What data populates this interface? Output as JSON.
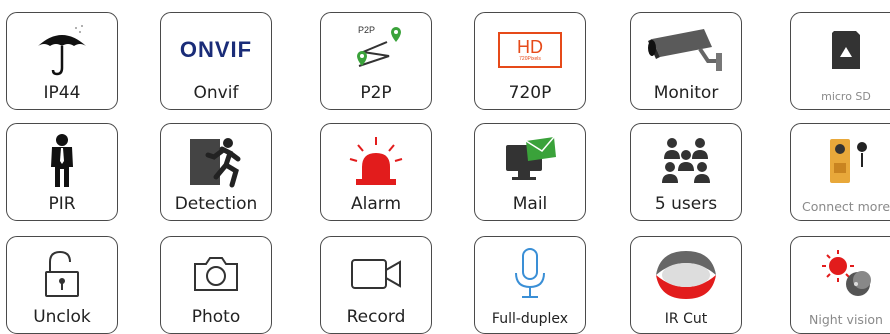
{
  "tiles": [
    {
      "label": "IP44",
      "icon": "umbrella-icon"
    },
    {
      "label": "Onvif",
      "icon": "onvif-logo-icon",
      "logo_text": "ONVIF"
    },
    {
      "label": "P2P",
      "icon": "p2p-route-icon",
      "icon_text": "P2P"
    },
    {
      "label": "720P",
      "icon": "hd-icon",
      "icon_text": "HD",
      "icon_subtext": "720Pixels"
    },
    {
      "label": "Monitor",
      "icon": "security-camera-icon"
    },
    {
      "label": "",
      "icon": "micro-sd-icon",
      "icon_text": "micro SD"
    },
    {
      "label": "PIR",
      "icon": "person-icon"
    },
    {
      "label": "Detection",
      "icon": "running-man-icon"
    },
    {
      "label": "Alarm",
      "icon": "siren-icon"
    },
    {
      "label": "Mail",
      "icon": "mail-monitor-icon"
    },
    {
      "label": "5 users",
      "icon": "users-group-icon"
    },
    {
      "label": "Connect more",
      "icon": "sensors-icon"
    },
    {
      "label": "Unclok",
      "icon": "unlock-icon"
    },
    {
      "label": "Photo",
      "icon": "camera-icon"
    },
    {
      "label": "Record",
      "icon": "video-camera-icon"
    },
    {
      "label": "Full-duplex",
      "icon": "microphone-icon"
    },
    {
      "label": "IR Cut",
      "icon": "ir-cut-icon"
    },
    {
      "label": "Night vision",
      "icon": "sun-moon-icon"
    }
  ],
  "colors": {
    "border": "#4a4a4a",
    "onvif_blue": "#1a2c78",
    "hd_orange": "#e64a19",
    "alarm_red": "#e21c1c",
    "mail_green": "#3aa23a",
    "mic_blue": "#3a8fd6"
  }
}
